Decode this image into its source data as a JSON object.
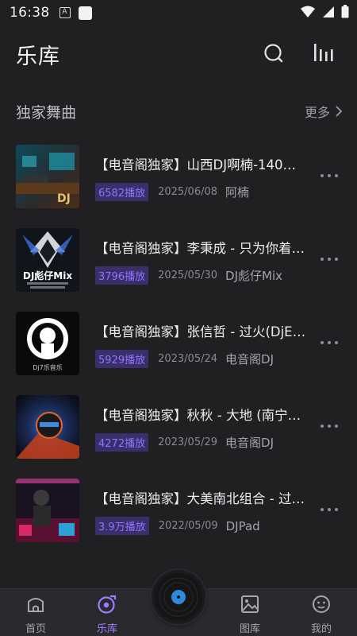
{
  "status_bar": {
    "time": "16:38",
    "notification_letter": "A"
  },
  "header": {
    "title": "乐库"
  },
  "section": {
    "title": "独家舞曲",
    "more_label": "更多"
  },
  "tracks": [
    {
      "title": "【电音阁独家】山西DJ啊楠-140…",
      "plays": "6582播放",
      "date": "2025/06/08",
      "author": "阿楠"
    },
    {
      "title": "【电音阁独家】李秉成 - 只为你着…",
      "plays": "3796播放",
      "date": "2025/05/30",
      "author": "DJ彪仔Mix"
    },
    {
      "title": "【电音阁独家】张信哲 - 过火(DjE…",
      "plays": "5929播放",
      "date": "2023/05/24",
      "author": "电音阁DJ"
    },
    {
      "title": "【电音阁独家】秋秋 - 大地 (南宁D…",
      "plays": "4272播放",
      "date": "2023/05/29",
      "author": "电音阁DJ"
    },
    {
      "title": "【电音阁独家】大美南北组合 - 过…",
      "plays": "3.9万播放",
      "date": "2022/05/09",
      "author": "DJPad"
    }
  ],
  "covers": [
    {
      "text": "DJ"
    },
    {
      "text": "DJ彪仔Mix"
    },
    {
      "text": "Dj7乐音乐"
    },
    {
      "text": ""
    },
    {
      "text": ""
    }
  ],
  "nav": {
    "items": [
      {
        "label": "首页",
        "icon": "home-icon"
      },
      {
        "label": "乐库",
        "icon": "music-library-icon",
        "active": true
      },
      {
        "label": "图库",
        "icon": "gallery-icon"
      },
      {
        "label": "我的",
        "icon": "profile-icon"
      }
    ]
  },
  "colors": {
    "accent": "#9b7dff",
    "background": "#202023",
    "badge_bg": "#3a2f6a"
  }
}
